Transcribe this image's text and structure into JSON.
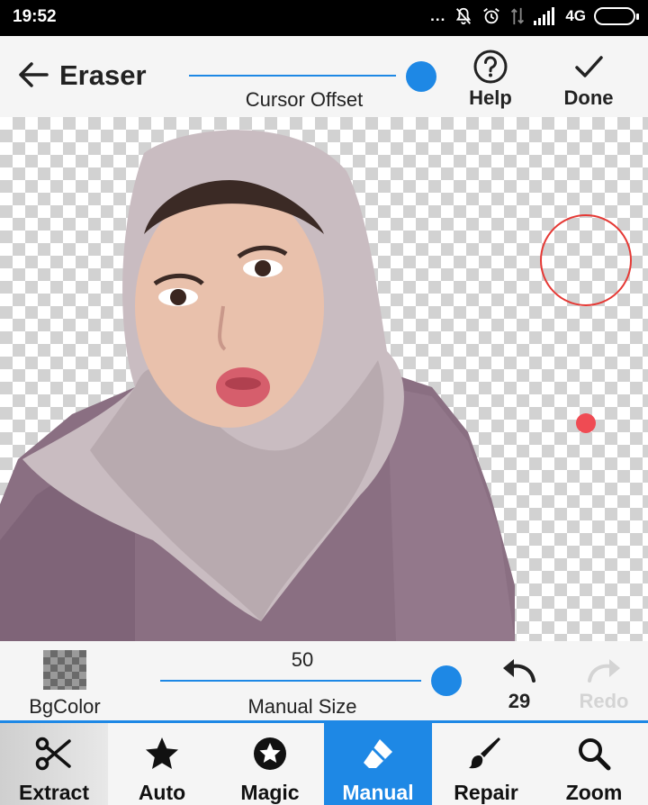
{
  "status_bar": {
    "time": "19:52",
    "dots": "...",
    "network": "4G",
    "icons": [
      "mute-icon",
      "alarm-icon",
      "data-icon",
      "signal-icon",
      "battery-icon"
    ]
  },
  "toolbar": {
    "title": "Eraser",
    "cursor_offset_label": "Cursor Offset",
    "help_label": "Help",
    "done_label": "Done",
    "cursor_offset_level": 1.0
  },
  "size_bar": {
    "bgcolor_label": "BgColor",
    "size_value": "50",
    "size_label": "Manual Size",
    "size_level": 1.0,
    "undo_count": "29",
    "redo_label": "Redo"
  },
  "tabs": [
    {
      "label": "Extract",
      "icon": "scissors-icon"
    },
    {
      "label": "Auto",
      "icon": "star-icon"
    },
    {
      "label": "Magic",
      "icon": "magic-star-icon"
    },
    {
      "label": "Manual",
      "icon": "eraser-icon",
      "active": true
    },
    {
      "label": "Repair",
      "icon": "brush-icon"
    },
    {
      "label": "Zoom",
      "icon": "search-icon"
    }
  ],
  "colors": {
    "accent": "#1e88e5",
    "cursor_ring": "#e53935",
    "cursor_dot": "#ef4b53",
    "toolbar_bg": "#f5f5f5"
  }
}
